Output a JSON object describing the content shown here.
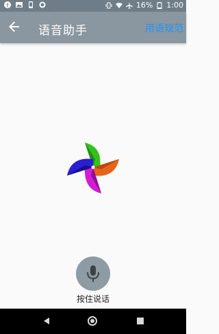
{
  "status_bar": {
    "battery": "16%",
    "time": "1:00",
    "icons": [
      "facebook-icon",
      "image-icon",
      "phone-icon",
      "circle-icon",
      "vibrate-icon",
      "wifi-icon",
      "airplane-icon",
      "battery-icon"
    ]
  },
  "app_bar": {
    "back_icon": "arrow-left-icon",
    "title": "语音助手",
    "action": "用语规范"
  },
  "center": {
    "icon": "pinwheel-icon"
  },
  "voice": {
    "mic_icon": "microphone-icon",
    "label": "按住说话"
  },
  "nav": [
    "back-triangle-icon",
    "home-circle-icon",
    "recent-square-icon"
  ],
  "colors": {
    "appbar": "#8b97a0",
    "statusbar": "#6f7d88",
    "accent": "#2196f3",
    "mic": "#8e9ba3"
  }
}
